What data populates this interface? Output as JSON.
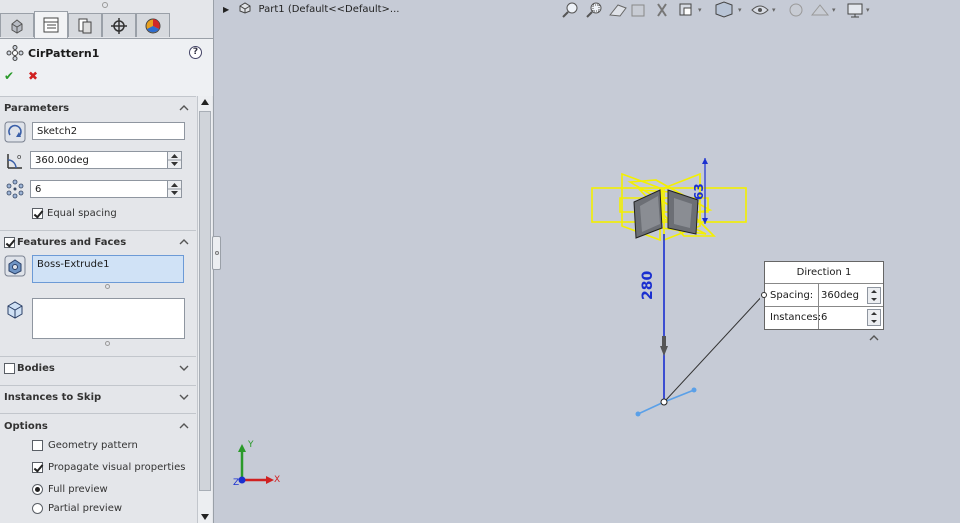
{
  "feature_manager": {
    "tabs": [
      {
        "icon": "feature-tree-icon"
      },
      {
        "icon": "property-manager-icon"
      },
      {
        "icon": "configuration-manager-icon"
      },
      {
        "icon": "dimxpert-icon"
      },
      {
        "icon": "display-manager-icon"
      }
    ],
    "active_tab": 1
  },
  "property_manager": {
    "title": "CirPattern1",
    "ok_label": "✔",
    "cancel_label": "✖",
    "help_label": "?",
    "parameters": {
      "title": "Parameters",
      "axis_value": "Sketch2",
      "angle_value": "360.00deg",
      "instances_value": "6",
      "equal_spacing_label": "Equal spacing",
      "equal_spacing_checked": true
    },
    "features_and_faces": {
      "title": "Features and Faces",
      "checked": true,
      "features_value": "Boss-Extrude1",
      "faces_value": ""
    },
    "bodies": {
      "title": "Bodies",
      "checked": false
    },
    "instances_to_skip": {
      "title": "Instances to Skip"
    },
    "options": {
      "title": "Options",
      "geometry_pattern_label": "Geometry pattern",
      "geometry_pattern_checked": false,
      "propagate_label": "Propagate visual properties",
      "propagate_checked": true,
      "full_preview_label": "Full preview",
      "partial_preview_label": "Partial preview",
      "preview_mode": "full"
    }
  },
  "viewport": {
    "breadcrumb": "Part1  (Default<<Default>...",
    "dimension_vertical": "280",
    "dimension_small": "63",
    "triad": {
      "x": "X",
      "y": "Y",
      "z": "Z"
    },
    "callout": {
      "title": "Direction 1",
      "spacing_label": "Spacing:",
      "spacing_value": "360deg",
      "instances_label": "Instances:",
      "instances_value": "6"
    }
  },
  "colors": {
    "preview_yellow": "#f4f000",
    "dimension_blue": "#1a2fd0",
    "panel_bg": "#e4e6ea",
    "viewport_bg": "#c6cbd6",
    "ok_green": "#2a9a2a",
    "cancel_red": "#d02020"
  }
}
